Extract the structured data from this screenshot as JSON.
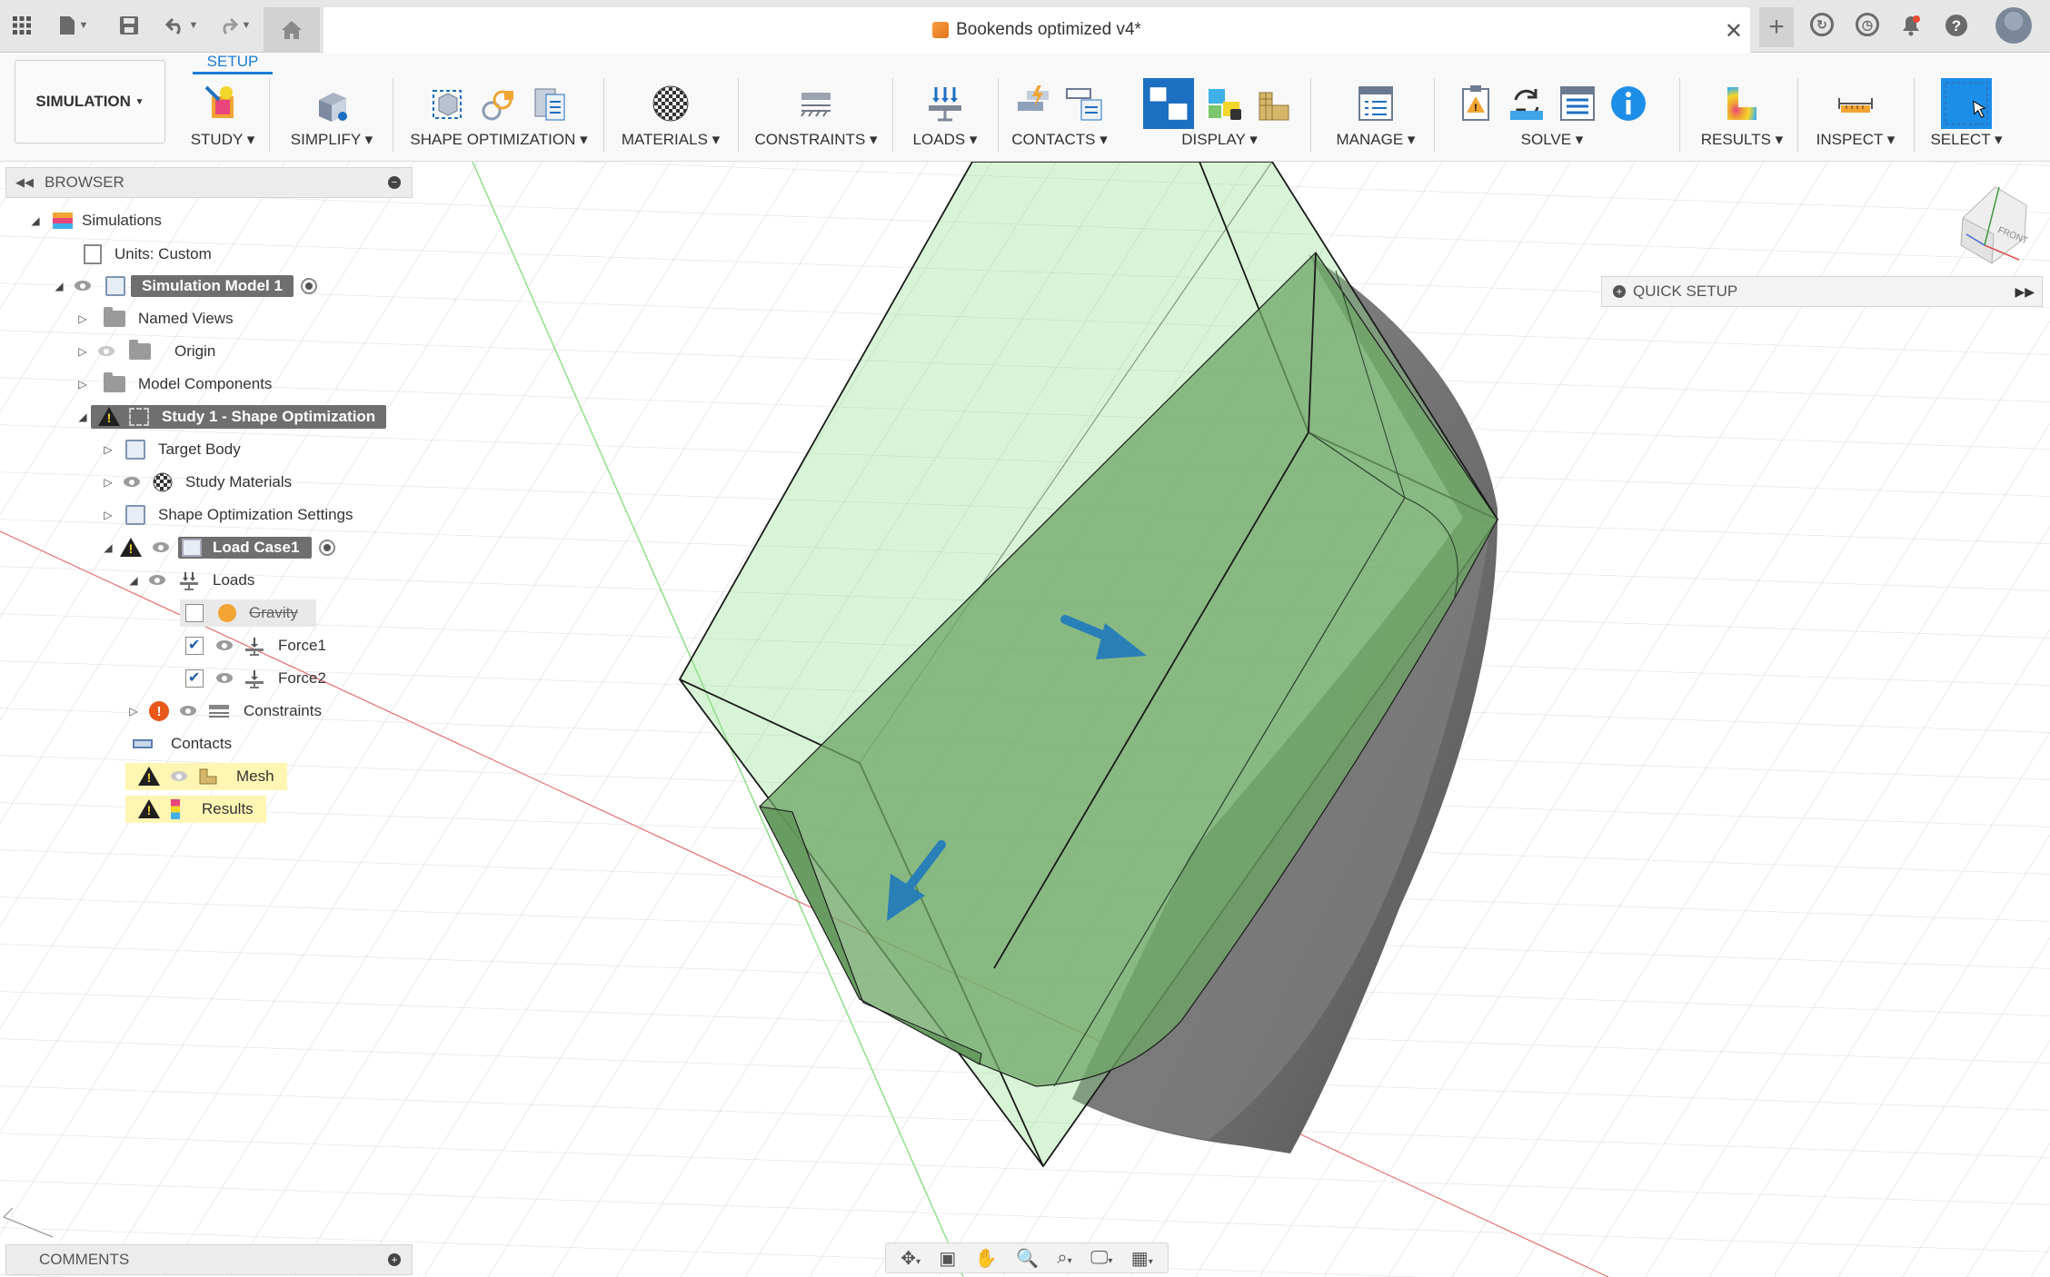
{
  "title_bar": {
    "document_title": "Bookends optimized v4*",
    "icons": [
      "apps-grid-icon",
      "file-icon",
      "save-icon",
      "undo-icon",
      "redo-icon",
      "home-icon",
      "close-icon",
      "new-tab-icon",
      "extensions-icon",
      "job-status-icon",
      "notifications-icon",
      "help-icon",
      "user-avatar"
    ]
  },
  "ribbon": {
    "workspace": "SIMULATION",
    "active_tab": "SETUP",
    "groups": [
      {
        "label": "STUDY"
      },
      {
        "label": "SIMPLIFY"
      },
      {
        "label": "SHAPE OPTIMIZATION"
      },
      {
        "label": "MATERIALS"
      },
      {
        "label": "CONSTRAINTS"
      },
      {
        "label": "LOADS"
      },
      {
        "label": "CONTACTS"
      },
      {
        "label": "DISPLAY"
      },
      {
        "label": "MANAGE"
      },
      {
        "label": "SOLVE"
      },
      {
        "label": "RESULTS"
      },
      {
        "label": "INSPECT"
      },
      {
        "label": "SELECT"
      }
    ]
  },
  "browser": {
    "title": "BROWSER",
    "tree": {
      "simulations": "Simulations",
      "units": "Units: Custom",
      "model": "Simulation Model 1",
      "named_views": "Named Views",
      "origin": "Origin",
      "model_components": "Model Components",
      "study": "Study 1 - Shape Optimization",
      "target_body": "Target Body",
      "study_materials": "Study Materials",
      "shape_opt_settings": "Shape Optimization Settings",
      "load_case": "Load Case1",
      "loads": "Loads",
      "gravity": "Gravity",
      "force1": "Force1",
      "force2": "Force2",
      "constraints": "Constraints",
      "contacts": "Contacts",
      "mesh": "Mesh",
      "results": "Results"
    },
    "checkboxes": {
      "gravity": false,
      "force1": true,
      "force2": true
    }
  },
  "quick_setup": {
    "label": "QUICK SETUP"
  },
  "comments": {
    "label": "COMMENTS"
  },
  "view_cube": {
    "face_label": "FRONT"
  },
  "colors": {
    "accent": "#1b7cd6",
    "design_space": "#8fe08a",
    "solid_body": "#6e6e6e",
    "warning": "#f5d22e",
    "error": "#e8571b"
  }
}
